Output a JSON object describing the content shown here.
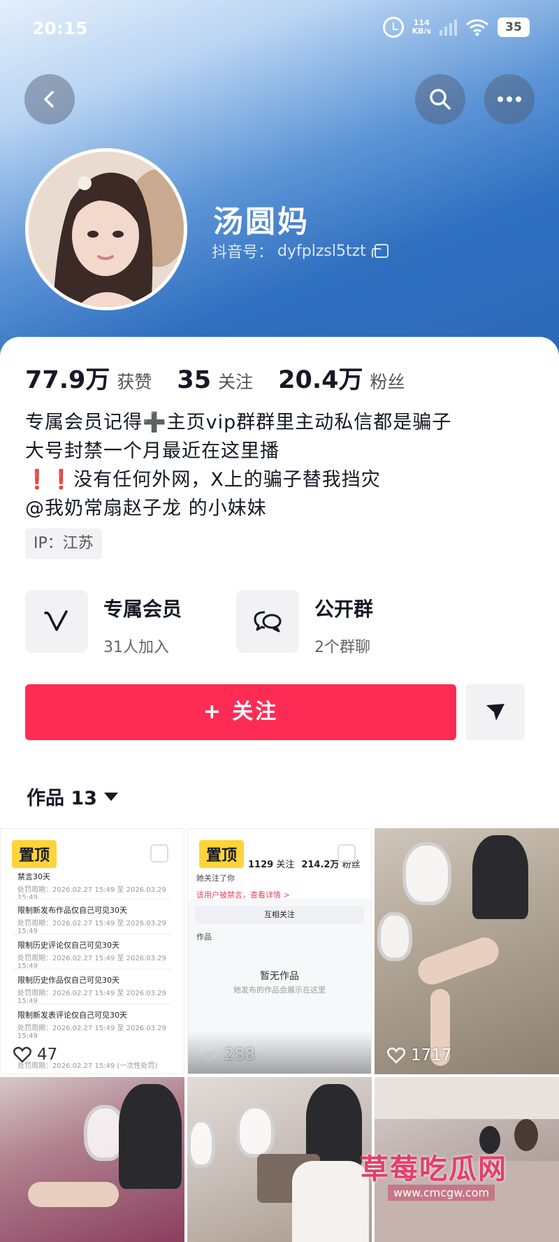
{
  "status_bar": {
    "time": "20:15",
    "net_speed_value": "114",
    "net_speed_unit": "KB/s",
    "battery": "35"
  },
  "profile": {
    "nickname": "汤圆妈",
    "douyin_id_label": "抖音号：",
    "douyin_id": "dyfplzsl5tzt"
  },
  "stats": [
    {
      "value": "77.9万",
      "label": "获赞"
    },
    {
      "value": "35",
      "label": "关注"
    },
    {
      "value": "20.4万",
      "label": "粉丝"
    }
  ],
  "bio": [
    "专属会员记得➕主页vip群群里主动私信都是骗子",
    "大号封禁一个月最近在这里播",
    "❗❗没有任何外网，X上的骗子替我挡灾",
    "@我奶常扇赵子龙 的小妹妹"
  ],
  "ip": "IP：江苏",
  "features": {
    "vip": {
      "title": "专属会员",
      "sub": "31人加入"
    },
    "group": {
      "title": "公开群",
      "sub": "2个群聊"
    }
  },
  "follow_label": "+ 关注",
  "works_tab": "作品 13",
  "grid": {
    "pinned_label": "置顶",
    "tiles": [
      {
        "likes": "47"
      },
      {
        "likes": "288"
      },
      {
        "likes": "1717"
      }
    ],
    "tile1_records": [
      {
        "title": "禁言30天",
        "sub": "处罚周期：2026.02.27 15:49 至 2026.03.29 15:49"
      },
      {
        "title": "限制新发布作品仅自己可见30天",
        "sub": "处罚周期：2026.02.27 15:49 至 2026.03.29 15:49"
      },
      {
        "title": "限制历史评论仅自己可见30天",
        "sub": "处罚周期：2026.02.27 15:49 至 2026.03.29 15:49"
      },
      {
        "title": "限制历史作品仅自己可见30天",
        "sub": "处罚周期：2026.02.27 15:49 至 2026.03.29 15:49"
      },
      {
        "title": "限制新发表评论仅自己可见30天",
        "sub": "处罚周期：2026.02.27 15:49 至 2026.03.29 15:49"
      }
    ],
    "tile1_footer": "处罚周期：2026.02.27 15:49 (一次性处罚)",
    "tile2": {
      "following": "1129",
      "following_label": "关注",
      "fans": "214.2万",
      "fans_label": "粉丝",
      "followed_you": "她关注了你",
      "banned_notice": "该用户被禁言，查看详情 >",
      "mutual_button": "互相关注",
      "works_label": "作品",
      "empty_title": "暂无作品",
      "empty_sub": "她发布的作品会展示在这里"
    }
  },
  "watermark": {
    "text": "草莓吃瓜网",
    "url": "www.cmcgw.com"
  },
  "colors": {
    "accent": "#fe2c55",
    "pinned": "#ffd43a",
    "header_blue": "#2f6fc0"
  }
}
